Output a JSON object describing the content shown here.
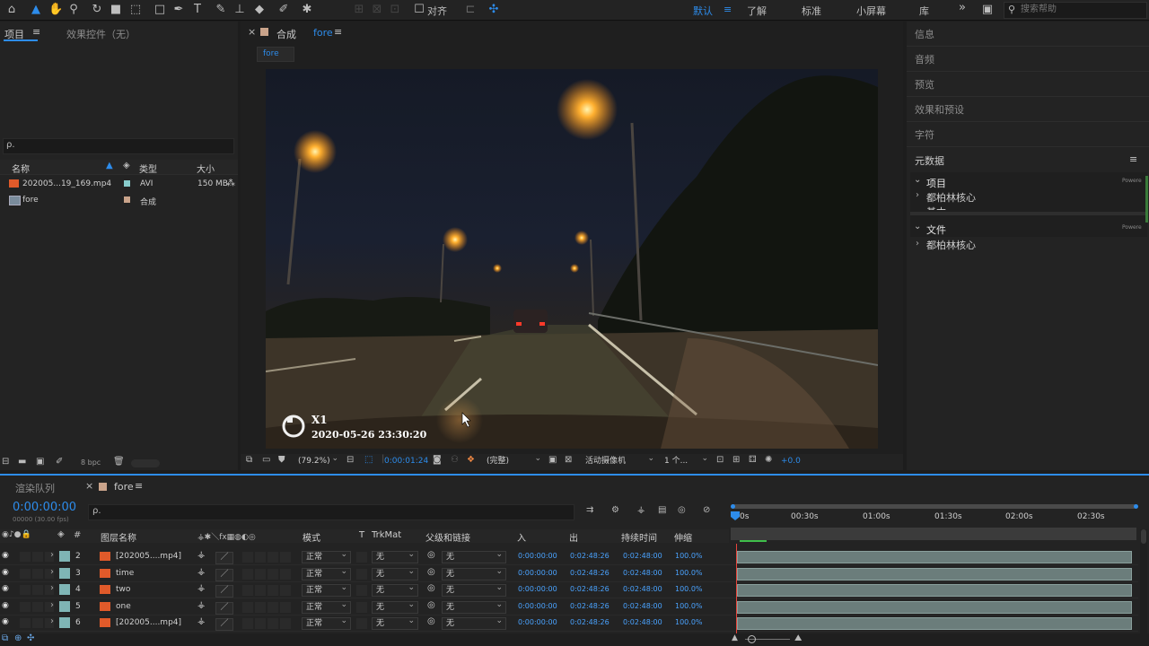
{
  "toolbar": {
    "snap_label": "对齐",
    "workspaces": [
      "默认",
      "了解",
      "标准",
      "小屏幕",
      "库"
    ],
    "more": "»",
    "search_placeholder": "搜索帮助",
    "icons": [
      "home-icon",
      "selection-tool-icon",
      "hand-tool-icon",
      "zoom-tool-icon",
      "rotate-tool-icon",
      "camera-tool-icon",
      "pan-behind-tool-icon",
      "rectangle-tool-icon",
      "pen-tool-icon",
      "type-tool-icon",
      "brush-tool-icon",
      "clone-stamp-icon",
      "eraser-icon",
      "roto-brush-icon",
      "puppet-pin-icon"
    ]
  },
  "project_panel": {
    "tab_project": "项目",
    "tab_effects": "效果控件（无）",
    "menu": "≡",
    "search_placeholder": "ρ.",
    "col_name": "名称",
    "col_type": "类型",
    "col_size": "大小",
    "items": [
      {
        "name": "202005...19_169.mp4",
        "type": "AVI",
        "size": "150 MB"
      },
      {
        "name": "fore",
        "type": "合成",
        "size": ""
      }
    ],
    "bpc": "8 bpc"
  },
  "comp_panel": {
    "close": "×",
    "title": "合成",
    "comp_name": "fore",
    "menu": "≡",
    "breadcrumb": "fore",
    "overlay_brand": "X1",
    "overlay_datetime": "2020-05-26  23:30:20",
    "zoom": "(79.2%)",
    "timecode": "0:00:01:24",
    "resolution": "(完整)",
    "camera": "活动摄像机",
    "views": "1 个...",
    "exposure": "+0.0"
  },
  "right_panel": {
    "items": [
      "信息",
      "音频",
      "预览",
      "效果和预设",
      "字符"
    ],
    "metadata_title": "元数据",
    "menu": "≡",
    "group1": "项目",
    "group1_sub1": "都柏林核心",
    "group1_sub2": "基本",
    "group2": "文件",
    "group2_sub1": "都柏林核心",
    "powered": "Powere"
  },
  "timeline": {
    "tab_render": "渲染队列",
    "tab_close": "×",
    "tab_comp": "fore",
    "menu": "≡",
    "timecode": "0:00:00:00",
    "fps": "00000 (30.00 fps)",
    "search_placeholder": "ρ.",
    "col_layer": "图层名称",
    "col_mode": "模式",
    "col_t": "T",
    "col_trkmat": "TrkMat",
    "col_parent": "父级和链接",
    "col_in": "入",
    "col_out": "出",
    "col_duration": "持续时间",
    "col_stretch": "伸缩",
    "ruler": [
      "0s",
      "00:30s",
      "01:00s",
      "01:30s",
      "02:00s",
      "02:30s"
    ],
    "layers": [
      {
        "num": "2",
        "name": "[202005....mp4]",
        "mode": "正常",
        "trkmat": "无",
        "parent": "无",
        "in": "0:00:00:00",
        "out": "0:02:48:26",
        "dur": "0:02:48:00",
        "stretch": "100.0%"
      },
      {
        "num": "3",
        "name": "time",
        "mode": "正常",
        "trkmat": "无",
        "parent": "无",
        "in": "0:00:00:00",
        "out": "0:02:48:26",
        "dur": "0:02:48:00",
        "stretch": "100.0%"
      },
      {
        "num": "4",
        "name": "two",
        "mode": "正常",
        "trkmat": "无",
        "parent": "无",
        "in": "0:00:00:00",
        "out": "0:02:48:26",
        "dur": "0:02:48:00",
        "stretch": "100.0%"
      },
      {
        "num": "5",
        "name": "one",
        "mode": "正常",
        "trkmat": "无",
        "parent": "无",
        "in": "0:00:00:00",
        "out": "0:02:48:26",
        "dur": "0:02:48:00",
        "stretch": "100.0%"
      },
      {
        "num": "6",
        "name": "[202005....mp4]",
        "mode": "正常",
        "trkmat": "无",
        "parent": "无",
        "in": "0:00:00:00",
        "out": "0:02:48:26",
        "dur": "0:02:48:00",
        "stretch": "100.0%"
      }
    ]
  },
  "colors": {
    "accent": "#2d8ceb",
    "playhead": "#e8443a",
    "layer_label": "#7fb5b5",
    "track_bar": "#6b7d7b"
  }
}
